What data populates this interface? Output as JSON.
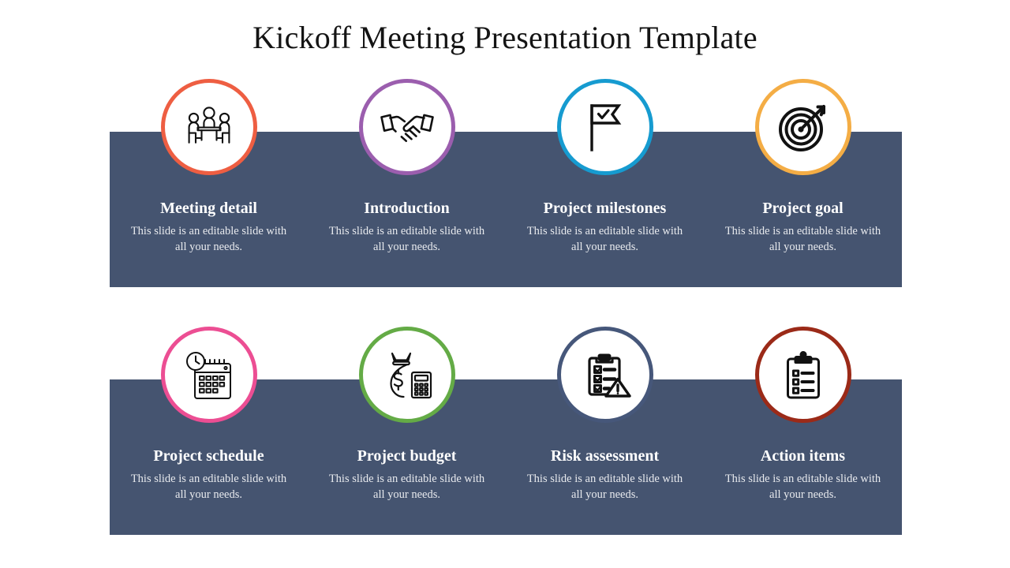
{
  "title": "Kickoff Meeting Presentation Template",
  "theme": {
    "band_color": "#455470",
    "page_background": "#ffffff",
    "heading_color": "#ffffff",
    "body_color": "#e8eaee",
    "title_color": "#141414",
    "icon_stroke": "#111111"
  },
  "rows": [
    {
      "cards": [
        {
          "heading": "Meeting detail",
          "body": "This slide is an editable slide with all your needs.",
          "icon": "meeting-people-table-icon",
          "ring_color": "#ee5e42"
        },
        {
          "heading": "Introduction",
          "body": "This slide is an editable slide with all your needs.",
          "icon": "handshake-icon",
          "ring_color": "#9b5eae"
        },
        {
          "heading": "Project milestones",
          "body": "This slide is an editable slide with all your needs.",
          "icon": "flag-check-icon",
          "ring_color": "#169bd0"
        },
        {
          "heading": "Project goal",
          "body": "This slide is an editable slide with all your needs.",
          "icon": "target-arrow-icon",
          "ring_color": "#f4ad45"
        }
      ]
    },
    {
      "cards": [
        {
          "heading": "Project schedule",
          "body": "This slide is an editable slide with all your needs.",
          "icon": "calendar-clock-icon",
          "ring_color": "#ec4e93"
        },
        {
          "heading": "Project budget",
          "body": "This slide is an editable slide with all your needs.",
          "icon": "money-bag-calculator-icon",
          "ring_color": "#64ab46"
        },
        {
          "heading": "Risk assessment",
          "body": "This slide is an editable slide with all your needs.",
          "icon": "clipboard-warning-icon",
          "ring_color": "#46577a"
        },
        {
          "heading": "Action items",
          "body": "This slide is an editable slide with all your needs.",
          "icon": "clipboard-list-icon",
          "ring_color": "#9b2a18"
        }
      ]
    }
  ]
}
